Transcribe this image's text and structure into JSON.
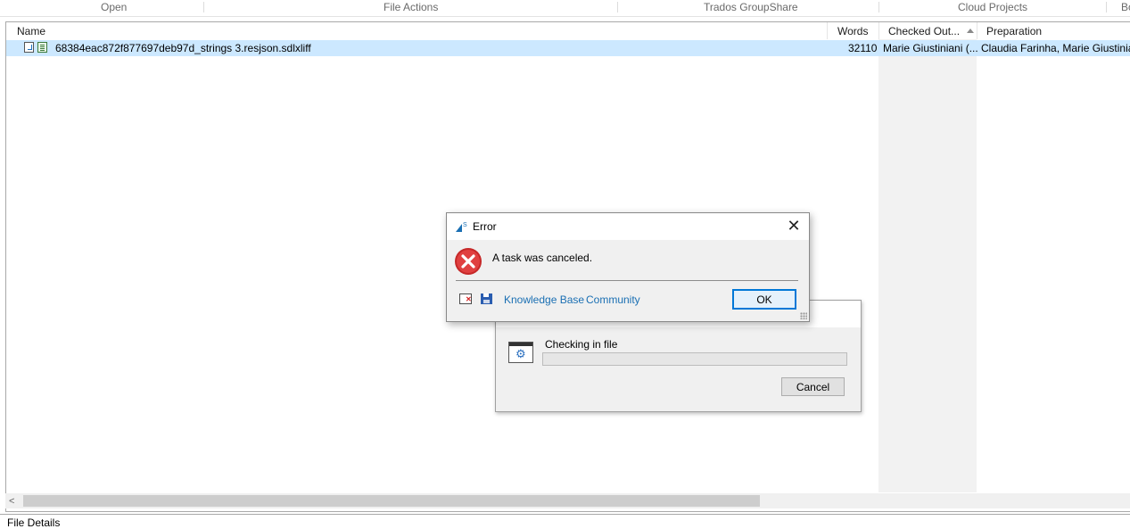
{
  "ribbon": {
    "groups": [
      "Open",
      "File Actions",
      "Trados GroupShare",
      "Cloud Projects",
      "Bo"
    ]
  },
  "grid": {
    "columns": [
      "Name",
      "Words",
      "Checked Out...",
      "Preparation"
    ],
    "rows": [
      {
        "name": "68384eac872f877697deb97d_strings 3.resjson.sdlxliff",
        "words": "32110",
        "checked_out": "Marie Giustiniani (...",
        "preparation": "Claudia Farinha, Marie Giustiniani"
      }
    ],
    "sorted_column_background": "#f2f2f2",
    "selected_row_color": "#cce8ff"
  },
  "scrollbar": {
    "left_arrow": "<"
  },
  "bottom_panel": {
    "title": "File Details"
  },
  "progress_dialog": {
    "message": "Checking in file",
    "progress": 0,
    "cancel_label": "Cancel",
    "icon": "gear-window-icon"
  },
  "error_dialog": {
    "title": "Error",
    "message": "A task was canceled.",
    "links": [
      "Knowledge Base",
      "Community"
    ],
    "ok_label": "OK",
    "close_glyph": "✕",
    "icons": [
      "app-icon",
      "error-icon",
      "window-error-icon",
      "save-icon",
      "close-icon"
    ],
    "link_color": "#1a6fb3",
    "error_red": "#d32020"
  }
}
